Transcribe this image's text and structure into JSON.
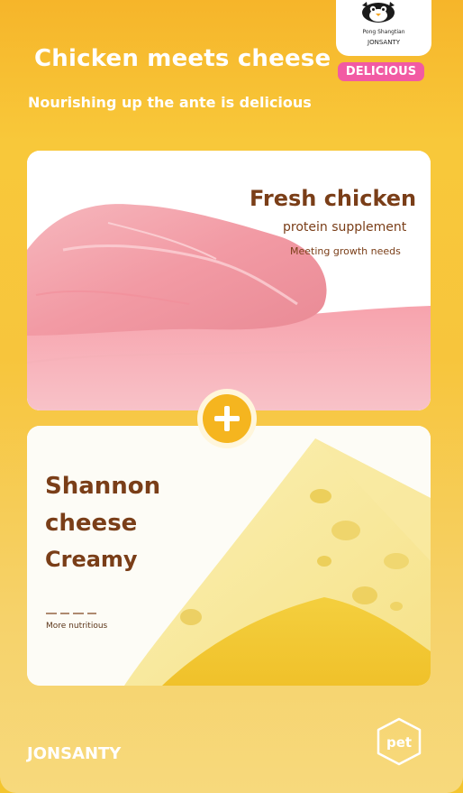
{
  "header": {
    "title": "Chicken meets cheese",
    "subtitle": "Nourishing up the ante is delicious"
  },
  "brand_tag": {
    "line1": "Pong Shangtian",
    "line2": "JONSANTY",
    "mascot_icon": "penguin-mascot-icon"
  },
  "badge": {
    "label": "DELICIOUS",
    "color": "#f25aa3"
  },
  "chicken_card": {
    "title": "Fresh chicken",
    "subtitle": "protein supplement",
    "note": "Meeting growth needs",
    "image_icon": "raw-chicken-image"
  },
  "connector": {
    "icon": "plus-icon"
  },
  "cheese_card": {
    "title_line1": "Shannon",
    "title_line2": "cheese",
    "title_line3": "Creamy",
    "note": "More nutritious",
    "image_icon": "cheese-wedge-image"
  },
  "footer": {
    "brand": "JONSANTY",
    "pet_label": "pet"
  },
  "colors": {
    "background": "#f7c53c",
    "text_brown": "#7a3e18",
    "accent_yellow": "#f5b51f",
    "white": "#ffffff"
  }
}
